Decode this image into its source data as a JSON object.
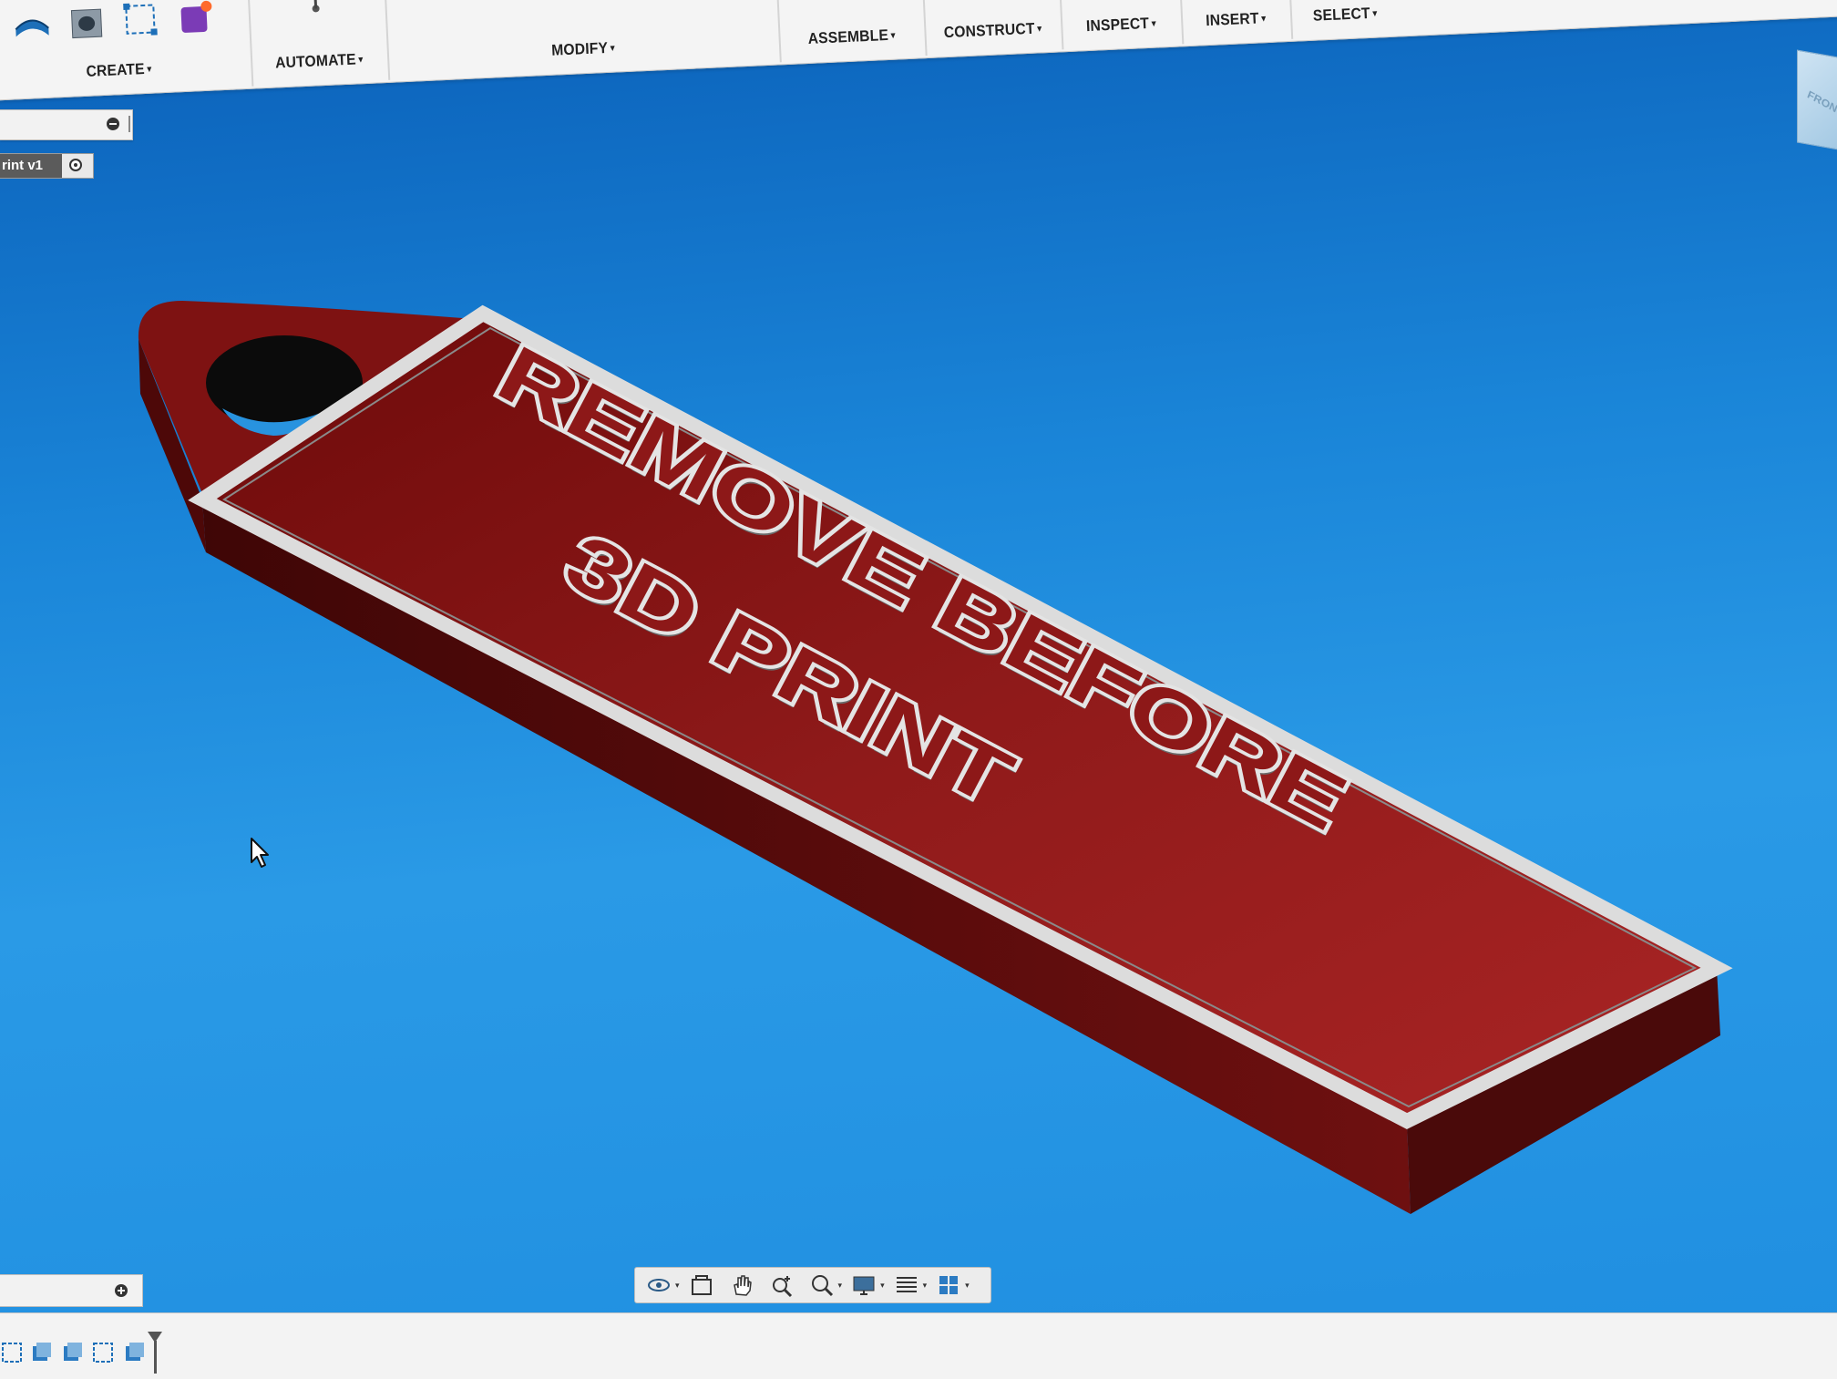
{
  "toolbar": {
    "groups": [
      {
        "label": "CREATE"
      },
      {
        "label": "AUTOMATE"
      },
      {
        "label": "MODIFY"
      },
      {
        "label": "ASSEMBLE"
      },
      {
        "label": "CONSTRUCT"
      },
      {
        "label": "INSPECT"
      },
      {
        "label": "INSERT"
      },
      {
        "label": "SELECT"
      }
    ],
    "caret": "▾"
  },
  "browser": {
    "component_name": "rint v1"
  },
  "viewcube": {
    "face_label": "FRON"
  },
  "model": {
    "text_line1": "REMOVE BEFORE",
    "text_line2": "3D PRINT",
    "colors": {
      "body_top": "#8e1a1a",
      "body_side": "#5a1010",
      "border": "#d9d9d9",
      "text": "#e4e4e4"
    }
  },
  "nav_bar": {
    "tools": [
      "orbit-icon",
      "look-at-icon",
      "pan-icon",
      "zoom-icon",
      "fit-icon",
      "display-settings-icon",
      "grid-settings-icon",
      "viewports-icon"
    ]
  },
  "timeline": {
    "items": [
      "sketch-icon",
      "extrude-icon",
      "extrude-icon",
      "sketch-icon",
      "extrude-icon"
    ]
  }
}
